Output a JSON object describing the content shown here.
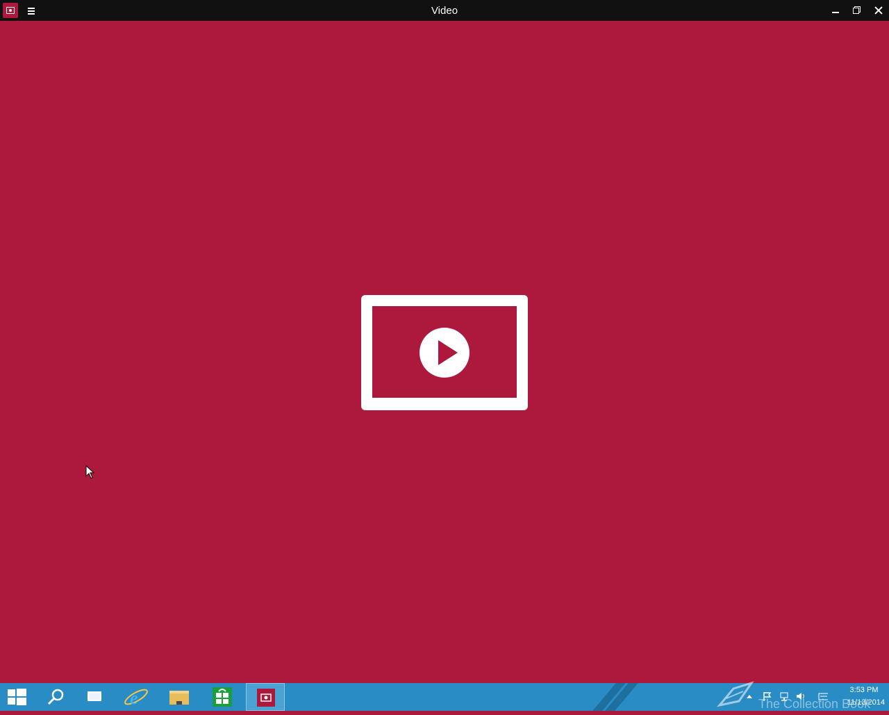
{
  "window": {
    "title": "Video",
    "app_icon": "video-app-icon",
    "menu_icon": "hamburger-icon",
    "controls": [
      "minimize-icon",
      "restore-icon",
      "close-icon"
    ]
  },
  "main": {
    "placeholder_icon": "video-play-icon"
  },
  "taskbar": {
    "items": [
      {
        "name": "start",
        "icon": "windows-logo-icon"
      },
      {
        "name": "search",
        "icon": "search-icon"
      },
      {
        "name": "task-view",
        "icon": "task-view-icon"
      },
      {
        "name": "internet-explorer",
        "icon": "internet-explorer-icon"
      },
      {
        "name": "file-explorer",
        "icon": "folder-icon"
      },
      {
        "name": "store",
        "icon": "store-icon"
      },
      {
        "name": "video",
        "icon": "video-app-icon",
        "active": true
      }
    ],
    "watermark": "The Collection Book",
    "clock": {
      "time": "3:53 PM",
      "date": "11/13/2014"
    }
  },
  "colors": {
    "background": "#ac193d",
    "titlebar": "#111111",
    "taskbar": "#2a8cc4"
  }
}
